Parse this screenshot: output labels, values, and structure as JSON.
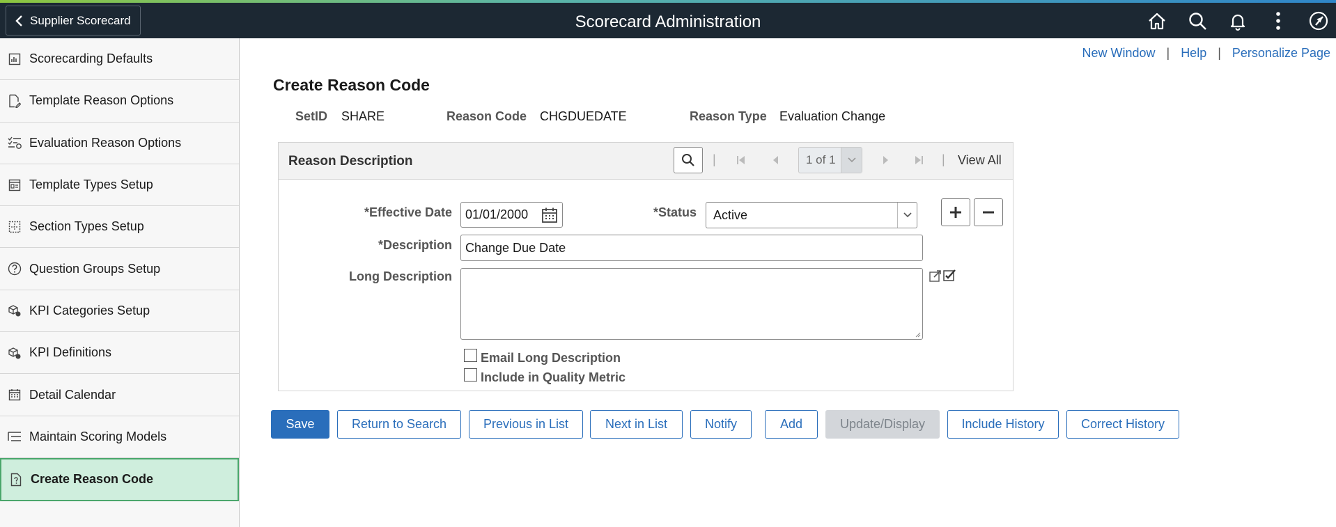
{
  "header": {
    "back_label": "Supplier Scorecard",
    "title": "Scorecard Administration",
    "icons": [
      "home-icon",
      "search-icon",
      "bell-icon",
      "more-vertical-icon",
      "navbar-compass-icon"
    ]
  },
  "sidebar": {
    "items": [
      {
        "label": "Scorecarding Defaults",
        "icon": "report-icon"
      },
      {
        "label": "Template Reason Options",
        "icon": "doc-edit-icon"
      },
      {
        "label": "Evaluation Reason Options",
        "icon": "checklist-icon"
      },
      {
        "label": "Template Types Setup",
        "icon": "layout-icon"
      },
      {
        "label": "Section Types Setup",
        "icon": "section-icon"
      },
      {
        "label": "Question Groups Setup",
        "icon": "question-icon"
      },
      {
        "label": "KPI Categories Setup",
        "icon": "cubes-icon"
      },
      {
        "label": "KPI Definitions",
        "icon": "cubes-icon"
      },
      {
        "label": "Detail Calendar",
        "icon": "calendar-icon"
      },
      {
        "label": "Maintain Scoring Models",
        "icon": "list-icon"
      },
      {
        "label": "Create Reason Code",
        "icon": "doc-question-icon",
        "active": true
      }
    ]
  },
  "toplinks": {
    "new_window": "New Window",
    "help": "Help",
    "personalize": "Personalize Page",
    "separator": "|"
  },
  "page": {
    "title": "Create Reason Code",
    "setid_label": "SetID",
    "setid_value": "SHARE",
    "reason_code_label": "Reason Code",
    "reason_code_value": "CHGDUEDATE",
    "reason_type_label": "Reason Type",
    "reason_type_value": "Evaluation Change"
  },
  "grid": {
    "title": "Reason Description",
    "pager": "1 of 1",
    "view_all": "View All",
    "separator": "|",
    "effective_date_label": "*Effective Date",
    "effective_date_value": "01/01/2000",
    "status_label": "*Status",
    "status_value": "Active",
    "description_label": "*Description",
    "description_value": "Change Due Date",
    "long_description_label": "Long Description",
    "long_description_value": "",
    "email_long_description_label": "Email Long Description",
    "email_long_description_checked": false,
    "include_quality_metric_label": "Include in Quality Metric",
    "include_quality_metric_checked": false
  },
  "buttons": {
    "save": "Save",
    "return_to_search": "Return to Search",
    "previous_in_list": "Previous in List",
    "next_in_list": "Next in List",
    "notify": "Notify",
    "add": "Add",
    "update_display": "Update/Display",
    "include_history": "Include History",
    "correct_history": "Correct History"
  },
  "colors": {
    "header_bg": "#1c2833",
    "link": "#2a6ebb",
    "active_item_bg": "#cfeedd",
    "active_item_border": "#4aa66b"
  }
}
